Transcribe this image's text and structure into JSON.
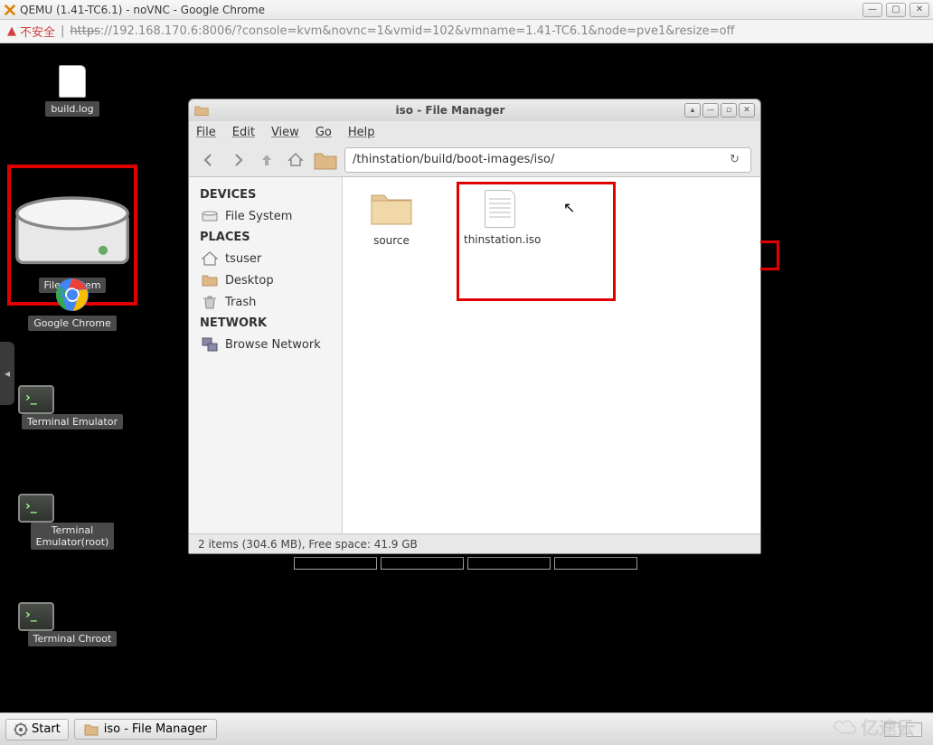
{
  "chrome": {
    "title": "QEMU (1.41-TC6.1) - noVNC - Google Chrome",
    "unsafe_label": "不安全",
    "url_https": "https",
    "url_rest": "://192.168.170.6:8006/?console=kvm&novnc=1&vmid=102&vmname=1.41-TC6.1&node=pve1&resize=off"
  },
  "desktop_icons": {
    "build_log": "build.log",
    "file_system": "File System",
    "google_chrome": "Google Chrome",
    "terminal_emulator": "Terminal Emulator",
    "terminal_emulator_root": "Terminal\nEmulator(root)",
    "terminal_chroot": "Terminal Chroot"
  },
  "fm": {
    "title": "iso - File Manager",
    "menu": {
      "file": "File",
      "edit": "Edit",
      "view": "View",
      "go": "Go",
      "help": "Help"
    },
    "path": "/thinstation/build/boot-images/iso/",
    "sidebar": {
      "devices_hdr": "DEVICES",
      "file_system": "File System",
      "places_hdr": "PLACES",
      "tsuser": "tsuser",
      "desktop": "Desktop",
      "trash": "Trash",
      "network_hdr": "NETWORK",
      "browse_network": "Browse Network"
    },
    "files": {
      "source": "source",
      "thinstation_iso": "thinstation.iso"
    },
    "status": "2 items (304.6 MB), Free space: 41.9 GB"
  },
  "taskbar": {
    "start": "Start",
    "task1": "iso - File Manager"
  },
  "watermark": "亿速云"
}
